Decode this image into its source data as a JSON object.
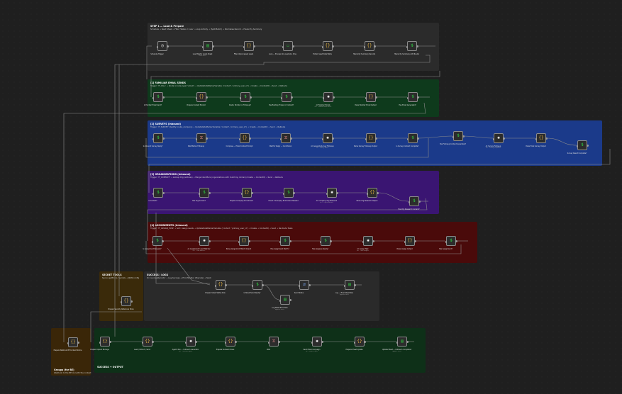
{
  "groups": [
    {
      "id": "g1",
      "title": "STEP 1 — Load & Prepare",
      "desc": "Schedule → Read Sheet → Filter 'Status = new' → Loop Activity → (Split Batch) → Normalise Record → Hierarchy Summary",
      "color": "#2b2b2b"
    },
    {
      "id": "g2",
      "title": "[1] FAMILIAR EMAIL SENDS",
      "desc": "Trigger: 'IF_CALL' → Router (route_type='email') → UpdateDataMarkerVariable ('contact', 'primary_user_id') → Create → ContextIQ → Send → ReRoute",
      "color": "#0e3a1c"
    },
    {
      "id": "g3",
      "title": "[2] SURVEYS (Inbound)",
      "desc": "Trigger: 'IF_SURVEY' Identify (route_company) → UpdateDataMarkerVariable ('contact', 'primary_user_id') → Create → ContextIQ → Send → ReRoute",
      "color": "#1b3a8a"
    },
    {
      "id": "g4",
      "title": "[3] ORGANIZATIONS (Inbound)",
      "desc": "Trigger: 'IF_CONTACT' → Lookup Org (address) → Merge Identifiers (organizations with matching domain) Create → ContextIQ → Send → ReRoute",
      "color": "#3a1572"
    },
    {
      "id": "g5",
      "title": "[4] ASSIGNMENTS (Inbound)",
      "desc": "Trigger: 'IF_ASSIGN_TASK' → Sort: Assign Leads → UpdateDataMarkerVariable ('contact', 'primary_user_id') → Create → ContextIQ → Send → Re-Route Tasks",
      "color": "#4a0a0a"
    },
    {
      "id": "g6",
      "title": "SECRET TOOLS",
      "desc": "Secure getEnv() / Secrets → JSON config",
      "color": "#3a2a0a"
    },
    {
      "id": "g7",
      "title": "SUCCESS / LOGS",
      "desc": "On 'successRecords' → Log_Success + ErrorHandler (Execute) → Slack",
      "color": "#2a2a2a"
    },
    {
      "id": "g8",
      "title": "Groups (for BE)",
      "desc": "Webhook to the BE tool with the context",
      "color": "#3a2608"
    },
    {
      "id": "g9",
      "title": "SUCCESS + OUTPUT",
      "desc": "",
      "color": "#0e3018"
    }
  ],
  "nodes": {
    "g1": [
      {
        "label": "Schedule Trigger",
        "sub": "",
        "icon": "clock-icon",
        "glyph": "◷",
        "color": "#dddddd"
      },
      {
        "label": "Load Master Leads Sheet",
        "sub": "read: sheet",
        "icon": "sheet-icon",
        "glyph": "▤",
        "color": "#2ecc40"
      },
      {
        "label": "Filter Unprocessed Leads",
        "sub": "",
        "icon": "code-icon",
        "glyph": "{}",
        "color": "#e0b040"
      },
      {
        "label": "Loop — Process One Lead at a time",
        "sub": "",
        "icon": "batch-icon",
        "glyph": "▭",
        "color": "#2ecc40"
      },
      {
        "label": "Extract Lead Data Fields",
        "sub": "",
        "icon": "code-icon",
        "glyph": "{}",
        "color": "#e0b040"
      },
      {
        "label": "Hierarchy Summary Records",
        "sub": "",
        "icon": "code-icon",
        "glyph": "{}",
        "color": "#e0b040"
      },
      {
        "label": "Hierarchy Summary with Router",
        "sub": "",
        "icon": "switch-icon",
        "glyph": "⥮",
        "color": "#2ecc40"
      }
    ],
    "g2": [
      {
        "label": "Is Familiar Email Send?",
        "sub": "",
        "icon": "switch-icon",
        "glyph": "⥮",
        "color": "#2ecc40"
      },
      {
        "label": "Prepare Context Prompt",
        "sub": "",
        "icon": "code-icon",
        "glyph": "{}",
        "color": "#e0b040"
      },
      {
        "label": "Route: Familiar or Followup?",
        "sub": "",
        "icon": "switch-icon",
        "glyph": "⥮",
        "color": "#2ecc40"
      },
      {
        "label": "Has Existing Thread or Contact?",
        "sub": "",
        "icon": "switch-icon",
        "glyph": "⥮",
        "color": "#2ecc40"
      },
      {
        "label": "AI: Familiar Emails",
        "sub": "GPT · Familiar Email writer",
        "icon": "openai-icon",
        "glyph": "✺",
        "color": "#ffffff"
      },
      {
        "label": "Parse Familiar Email Output",
        "sub": "",
        "icon": "code-icon",
        "glyph": "{}",
        "color": "#e0b040"
      },
      {
        "label": "Has Email Generated?",
        "sub": "",
        "icon": "switch-icon",
        "glyph": "⥮",
        "color": "#2ecc40"
      }
    ],
    "g3": [
      {
        "label": "Is Inbound Survey Reply?",
        "sub": "",
        "icon": "switch-icon",
        "glyph": "⥮",
        "color": "#2ecc40"
      },
      {
        "label": "Wait Before Followup",
        "sub": "",
        "icon": "wait-icon",
        "glyph": "⧖",
        "color": "#d08080"
      },
      {
        "label": "Compose — Email Context Prompt",
        "sub": "",
        "icon": "code-icon",
        "glyph": "{}",
        "color": "#e0b040"
      },
      {
        "label": "Wait for Reply — Conditional",
        "sub": "",
        "icon": "wait-icon",
        "glyph": "⧖",
        "color": "#d08080"
      },
      {
        "label": "AI: Generate Survey Followup",
        "sub": "GPT · Survey writer",
        "icon": "openai-icon",
        "glyph": "✺",
        "color": "#ffffff"
      },
      {
        "label": "Parse Survey Followup Output",
        "sub": "",
        "icon": "code-icon",
        "glyph": "{}",
        "color": "#e0b040"
      },
      {
        "label": "Is Survey Content Complete?",
        "sub": "",
        "icon": "switch-icon",
        "glyph": "⥮",
        "color": "#2ecc40"
      },
      {
        "label": "Has Followup Content Generated?",
        "sub": "",
        "icon": "switch-icon",
        "glyph": "⥮",
        "color": "#2ecc40"
      },
      {
        "label": "AI: Survey Followup",
        "sub": "GPT · Survey responder",
        "icon": "openai-icon",
        "glyph": "✺",
        "color": "#ffffff"
      },
      {
        "label": "Parse Final Survey Output",
        "sub": "",
        "icon": "code-icon",
        "glyph": "{}",
        "color": "#e0b040"
      },
      {
        "label": "Survey Result Complete?",
        "sub": "",
        "icon": "switch-icon",
        "glyph": "⥮",
        "color": "#2ecc40"
      }
    ],
    "g4": [
      {
        "label": "Is Contact?",
        "sub": "",
        "icon": "switch-icon",
        "glyph": "⥮",
        "color": "#2ecc40"
      },
      {
        "label": "Has Org Domain?",
        "sub": "",
        "icon": "switch-icon",
        "glyph": "⥮",
        "color": "#2ecc40"
      },
      {
        "label": "Prepare Company Enrichment",
        "sub": "",
        "icon": "code-icon",
        "glyph": "{}",
        "color": "#e0b040"
      },
      {
        "label": "Check if Company Enrichment Needed",
        "sub": "",
        "icon": "switch-icon",
        "glyph": "⥮",
        "color": "#2ecc40"
      },
      {
        "label": "AI: Company Org Research",
        "sub": "GPT · Org researcher",
        "icon": "openai-icon",
        "glyph": "✺",
        "color": "#ffffff"
      },
      {
        "label": "Parse Org Research Output",
        "sub": "",
        "icon": "code-icon",
        "glyph": "{}",
        "color": "#e0b040"
      },
      {
        "label": "Has Org Research Content?",
        "sub": "",
        "icon": "switch-icon",
        "glyph": "⥮",
        "color": "#2ecc40"
      }
    ],
    "g5": [
      {
        "label": "Is Assignment Request?",
        "sub": "",
        "icon": "switch-icon",
        "glyph": "⥮",
        "color": "#2ecc40"
      },
      {
        "label": "AI: Assignment Lead Matcher",
        "sub": "GPT · Lead matcher",
        "icon": "openai-icon",
        "glyph": "✺",
        "color": "#ffffff"
      },
      {
        "label": "Parse Assignment Match Output",
        "sub": "",
        "icon": "code-icon",
        "glyph": "{}",
        "color": "#e0b040"
      },
      {
        "label": "Has Assignment Match?",
        "sub": "",
        "icon": "switch-icon",
        "glyph": "⥮",
        "color": "#2ecc40"
      },
      {
        "label": "Has Assignee Ready?",
        "sub": "",
        "icon": "switch-icon",
        "glyph": "⥮",
        "color": "#2ecc40"
      },
      {
        "label": "AI: Assign Task",
        "sub": "GPT · Task assigner",
        "icon": "openai-icon",
        "glyph": "✺",
        "color": "#ffffff"
      },
      {
        "label": "Parse Assign Output",
        "sub": "",
        "icon": "code-icon",
        "glyph": "{}",
        "color": "#e0b040"
      },
      {
        "label": "Has Assignment?",
        "sub": "",
        "icon": "switch-icon",
        "glyph": "⥮",
        "color": "#2ecc40"
      }
    ],
    "g6": [
      {
        "label": "Prepare Security Reference Store",
        "sub": "",
        "icon": "code-icon",
        "glyph": "{}",
        "color": "#e0b040"
      }
    ],
    "g7": [
      {
        "label": "Prepare Sheet Status Row",
        "sub": "",
        "icon": "code-icon",
        "glyph": "{}",
        "color": "#e0b040"
      },
      {
        "label": "Is Sheet Send Ready?",
        "sub": "",
        "icon": "switch-icon",
        "glyph": "⥮",
        "color": "#2ecc40"
      },
      {
        "label": "Send Status",
        "sub": "",
        "icon": "http-icon",
        "glyph": "⇄",
        "color": "#7fb0ff"
      },
      {
        "label": "Log — Final Sheet Row",
        "sub": "append: sheet",
        "icon": "sheet-icon",
        "glyph": "▤",
        "color": "#2ecc40"
      },
      {
        "label": "Log Failed Error Row",
        "sub": "append: sheet",
        "icon": "sheet-icon",
        "glyph": "▤",
        "color": "#2ecc40"
      }
    ],
    "g8": [
      {
        "label": "Prepare Webhook BE Context Notice",
        "sub": "",
        "icon": "code-icon",
        "glyph": "{}",
        "color": "#e0b040"
      }
    ],
    "g9": [
      {
        "label": "Prepare Upload Package",
        "sub": "",
        "icon": "code-icon",
        "glyph": "{}",
        "color": "#e0b040"
      },
      {
        "label": "Lead / Extract / Send",
        "sub": "",
        "icon": "code-icon",
        "glyph": "{}",
        "color": "#e0b040"
      },
      {
        "label": "Agent: Run — Outreach Generator",
        "sub": "GPT · Outreach agent",
        "icon": "openai-icon",
        "glyph": "✺",
        "color": "#ffffff"
      },
      {
        "label": "Prepare Outreach Rows",
        "sub": "",
        "icon": "code-icon",
        "glyph": "{}",
        "color": "#e0b040"
      },
      {
        "label": "Wait",
        "sub": "",
        "icon": "wait-icon",
        "glyph": "⧖",
        "color": "#d08080"
      },
      {
        "label": "Send Email Campaign",
        "sub": "GPT · Email sender",
        "icon": "openai-icon",
        "glyph": "✺",
        "color": "#ffffff"
      },
      {
        "label": "Prepare Sheet Update",
        "sub": "",
        "icon": "code-icon",
        "glyph": "{}",
        "color": "#e0b040"
      },
      {
        "label": "Update Sheet — Outreach Completed",
        "sub": "update: sheet",
        "icon": "sheet-icon",
        "glyph": "▤",
        "color": "#2ecc40"
      }
    ]
  }
}
